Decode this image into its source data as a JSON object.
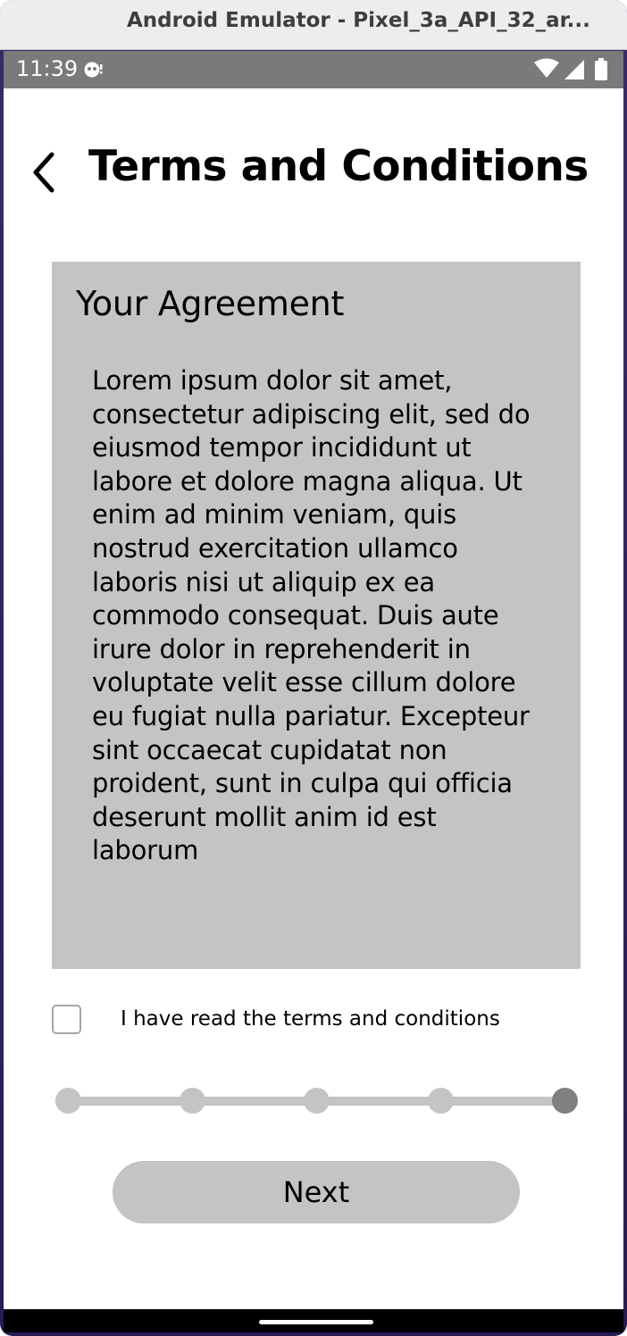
{
  "window": {
    "title": "Android Emulator - Pixel_3a_API_32_ar..."
  },
  "status_bar": {
    "time": "11:39",
    "icons": [
      "notification-icon",
      "wifi-icon",
      "signal-icon",
      "battery-icon"
    ]
  },
  "header": {
    "back_icon": "chevron-left-icon",
    "title": "Terms and Conditions"
  },
  "agreement": {
    "title": "Your Agreement",
    "body": "Lorem ipsum dolor sit amet, consectetur adipiscing elit, sed do eiusmod tempor incididunt ut labore et dolore magna aliqua. Ut enim ad minim veniam, quis nostrud exercitation ullamco laboris nisi ut aliquip ex ea commodo consequat. Duis aute irure dolor in reprehenderit in voluptate velit esse cillum dolore eu fugiat nulla pariatur. Excepteur sint occaecat cupidatat non proident, sunt in culpa qui officia deserunt mollit anim id est laborum"
  },
  "consent": {
    "checked": false,
    "label": "I have read the terms and conditions"
  },
  "progress": {
    "total_steps": 5,
    "current_step": 5
  },
  "actions": {
    "next_label": "Next"
  },
  "colors": {
    "card_background": "#c4c4c4",
    "step_inactive": "#c4c4c4",
    "step_active": "#808080",
    "status_bar": "#7a7a7a",
    "title_bar": "#eeecef"
  }
}
